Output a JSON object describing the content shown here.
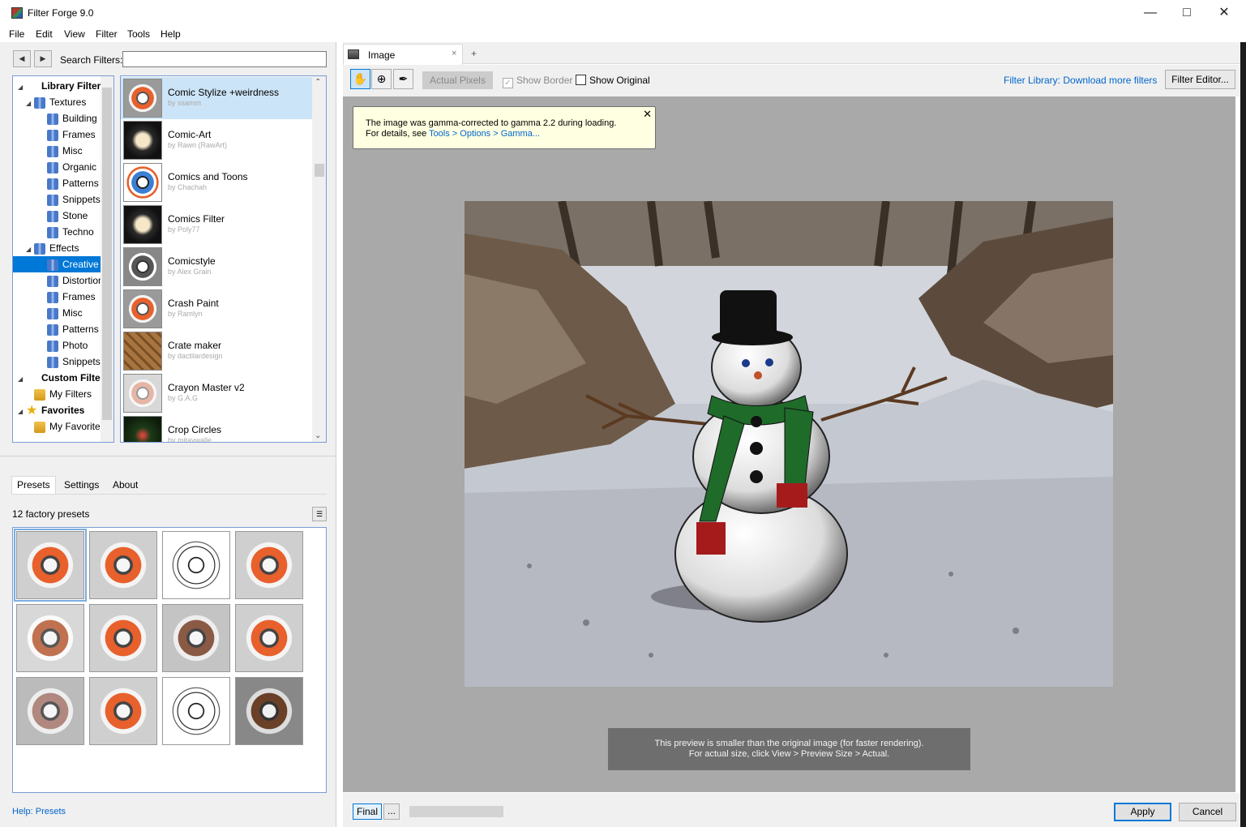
{
  "window": {
    "title": "Filter Forge 9.0",
    "minimize_icon": "minimize-icon",
    "maximize_icon": "maximize-icon",
    "close_icon": "close-icon"
  },
  "menu": [
    "File",
    "Edit",
    "View",
    "Filter",
    "Tools",
    "Help"
  ],
  "search": {
    "label": "Search Filters:",
    "value": ""
  },
  "tree": [
    {
      "label": "Library Filters",
      "level": 0,
      "icon": "library",
      "bold": true
    },
    {
      "label": "Textures",
      "level": 1,
      "icon": "folder"
    },
    {
      "label": "Building",
      "level": 2,
      "icon": "folder"
    },
    {
      "label": "Frames",
      "level": 2,
      "icon": "folder"
    },
    {
      "label": "Misc",
      "level": 2,
      "icon": "folder"
    },
    {
      "label": "Organic",
      "level": 2,
      "icon": "folder"
    },
    {
      "label": "Patterns",
      "level": 2,
      "icon": "folder"
    },
    {
      "label": "Snippets",
      "level": 2,
      "icon": "folder"
    },
    {
      "label": "Stone",
      "level": 2,
      "icon": "folder"
    },
    {
      "label": "Techno",
      "level": 2,
      "icon": "folder"
    },
    {
      "label": "Effects",
      "level": 1,
      "icon": "folder"
    },
    {
      "label": "Creative",
      "level": 2,
      "icon": "folder",
      "selected": true
    },
    {
      "label": "Distortion",
      "level": 2,
      "icon": "folder"
    },
    {
      "label": "Frames",
      "level": 2,
      "icon": "folder"
    },
    {
      "label": "Misc",
      "level": 2,
      "icon": "folder"
    },
    {
      "label": "Patterns",
      "level": 2,
      "icon": "folder"
    },
    {
      "label": "Photo",
      "level": 2,
      "icon": "folder"
    },
    {
      "label": "Snippets",
      "level": 2,
      "icon": "folder"
    },
    {
      "label": "Custom Filters",
      "level": 0,
      "icon": "library",
      "bold": true
    },
    {
      "label": "My Filters",
      "level": 1,
      "icon": "yfolder"
    },
    {
      "label": "Favorites",
      "level": 0,
      "icon": "star",
      "bold": true
    },
    {
      "label": "My Favorites",
      "level": 1,
      "icon": "yfolder"
    }
  ],
  "filters": [
    {
      "name": "Comic Stylize +weirdness",
      "author": "by ssamm",
      "thumb": "",
      "selected": true
    },
    {
      "name": "Comic-Art",
      "author": "by Rawn (RawArt)",
      "thumb": "dark"
    },
    {
      "name": "Comics and Toons",
      "author": "by Chachah",
      "thumb": "blue"
    },
    {
      "name": "Comics Filter",
      "author": "by Poly77",
      "thumb": "dark"
    },
    {
      "name": "Comicstyle",
      "author": "by Alex Grain",
      "thumb": "grey"
    },
    {
      "name": "Crash Paint",
      "author": "by Ramlyn",
      "thumb": ""
    },
    {
      "name": "Crate maker",
      "author": "by dactilardesign",
      "thumb": "wood"
    },
    {
      "name": "Crayon Master v2",
      "author": "by G.A.G",
      "thumb": "pale"
    },
    {
      "name": "Crop Circles",
      "author": "by mitavwalle",
      "thumb": "green"
    }
  ],
  "tabs": {
    "presets": "Presets",
    "settings": "Settings",
    "about": "About"
  },
  "presets_count": "12 factory presets",
  "presets": [
    "",
    "",
    "line",
    "",
    "rust",
    "",
    "brown",
    "",
    "pink",
    "",
    "line",
    "darkbrown"
  ],
  "help_link": "Help: Presets",
  "doc_tab": {
    "label": "Image",
    "close": "×",
    "add": "+"
  },
  "toolbar": {
    "actual_pixels": "Actual Pixels",
    "show_border": "Show Border",
    "show_original": "Show Original",
    "library_link": "Filter Library: Download more filters",
    "editor_button": "Filter Editor..."
  },
  "gamma_note": {
    "line1": "The image was gamma-corrected to gamma 2.2 during loading.",
    "line2_prefix": "For details, see ",
    "line2_link": "Tools > Options > Gamma..."
  },
  "preview_note": {
    "line1": "This preview is smaller than the original image (for faster rendering).",
    "line2": "For actual size, click View > Preview Size > Actual."
  },
  "bottom": {
    "final": "Final",
    "more": "...",
    "apply": "Apply",
    "cancel": "Cancel"
  },
  "colors": {
    "accent": "#0078d7",
    "link": "#0066cc",
    "selection": "#cce4f7"
  }
}
